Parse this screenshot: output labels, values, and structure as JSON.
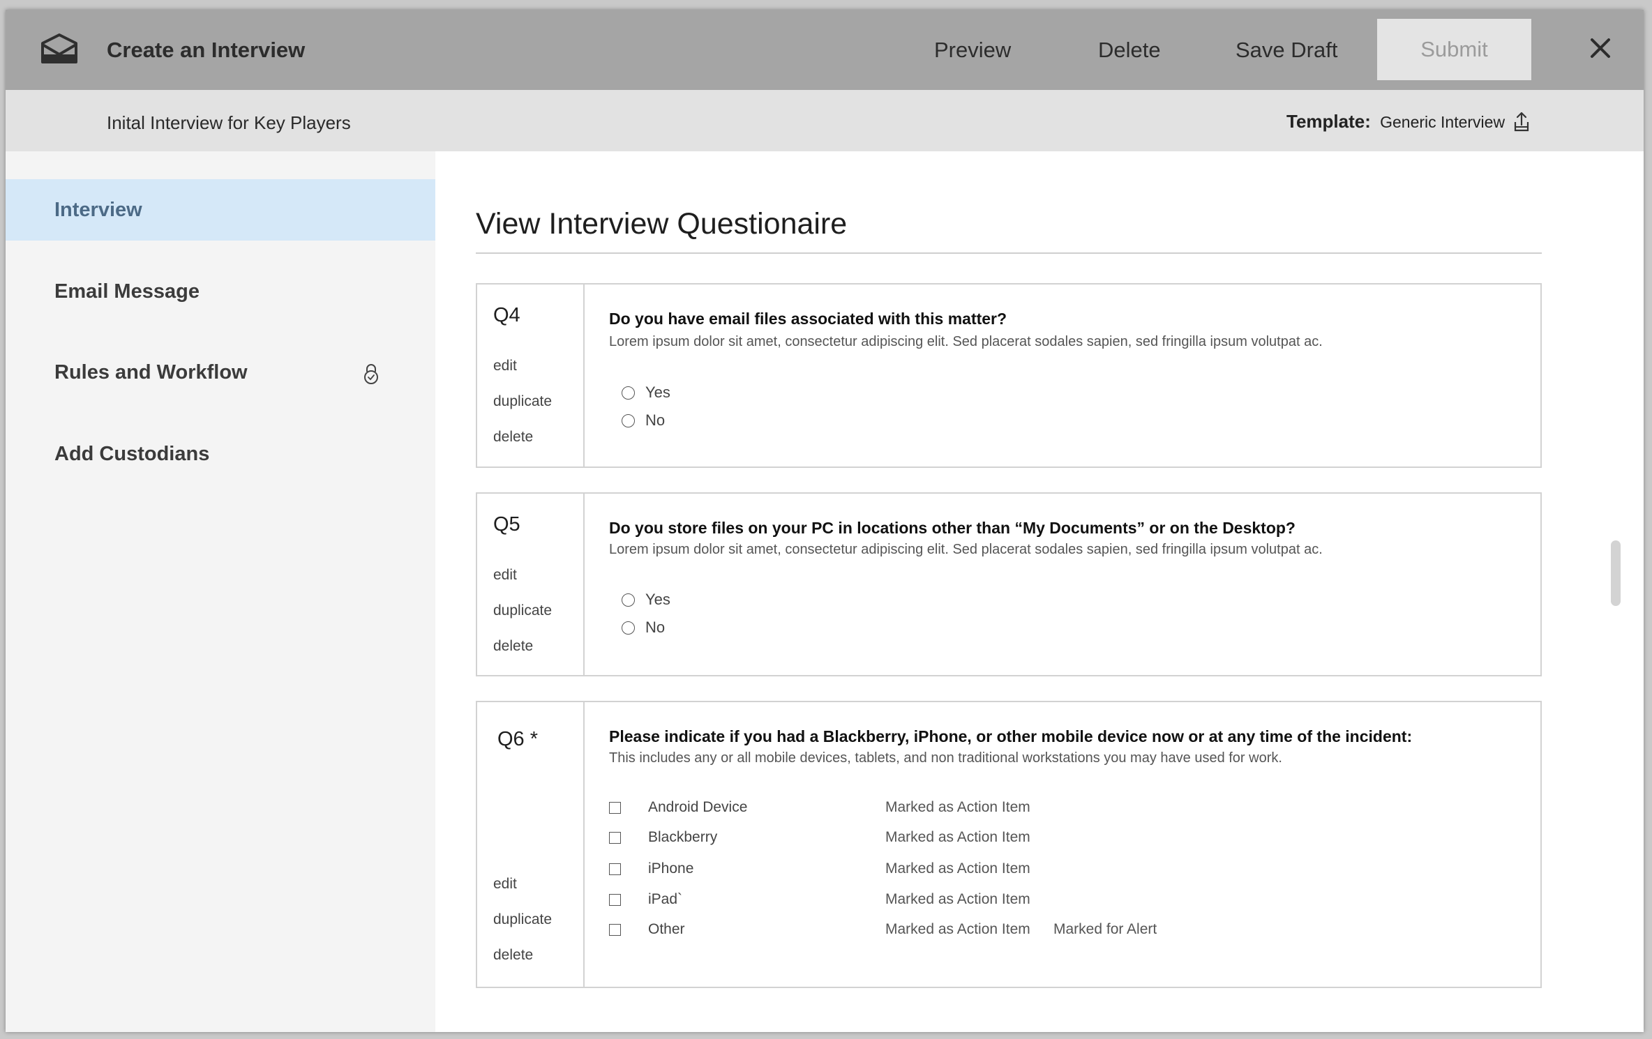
{
  "header": {
    "app_icon": "envelope-icon",
    "title": "Create an Interview",
    "actions": {
      "preview": "Preview",
      "delete": "Delete",
      "save_draft": "Save Draft",
      "submit": "Submit"
    },
    "close_icon": "close-icon"
  },
  "subheader": {
    "interview_name": "Inital Interview for Key Players",
    "template_label": "Template:",
    "template_value": "Generic Interview",
    "upload_icon": "upload-icon"
  },
  "sidebar": {
    "items": [
      {
        "label": "Interview",
        "active": true
      },
      {
        "label": "Email Message"
      },
      {
        "label": "Rules and Workflow",
        "icon": "lock-icon"
      },
      {
        "label": "Add Custodians"
      }
    ]
  },
  "main": {
    "title": "View Interview Questionaire",
    "questions": [
      {
        "number": "Q4",
        "actions": [
          "edit",
          "duplicate",
          "delete"
        ],
        "text": "Do you have email files associated with this matter?",
        "description": "Lorem ipsum dolor sit amet, consectetur adipiscing elit. Sed placerat sodales sapien, sed fringilla ipsum volutpat ac.",
        "options": [
          "Yes",
          "No"
        ]
      },
      {
        "number": "Q5",
        "actions": [
          "edit",
          "duplicate",
          "delete"
        ],
        "text": "Do you store files on your PC in locations other than “My Documents” or on the Desktop?",
        "description": "Lorem ipsum dolor sit amet, consectetur adipiscing elit. Sed placerat sodales sapien, sed fringilla ipsum volutpat ac.",
        "options": [
          "Yes",
          "No"
        ]
      },
      {
        "number": "Q6 *",
        "actions": [
          "edit",
          "duplicate",
          "delete"
        ],
        "text": "Please indicate if you had a Blackberry, iPhone, or other mobile device now or at any time of the incident:",
        "description": "This includes any or all mobile devices, tablets, and non traditional workstations you may have used for work.",
        "options": [
          {
            "label": "Android Device",
            "mark": "Marked as Action Item",
            "alert": ""
          },
          {
            "label": "Blackberry",
            "mark": "Marked as Action Item",
            "alert": ""
          },
          {
            "label": "iPhone",
            "mark": "Marked as Action Item",
            "alert": ""
          },
          {
            "label": "iPad`",
            "mark": "Marked as Action Item",
            "alert": ""
          },
          {
            "label": "Other",
            "mark": "Marked as Action Item",
            "alert": "Marked for Alert"
          }
        ]
      }
    ]
  },
  "colors": {
    "topbar": "#a5a5a5",
    "subbar": "#e2e2e2",
    "sidebar": "#f4f4f4",
    "active_item": "#d5e8f8",
    "active_text": "#4c6a86"
  }
}
